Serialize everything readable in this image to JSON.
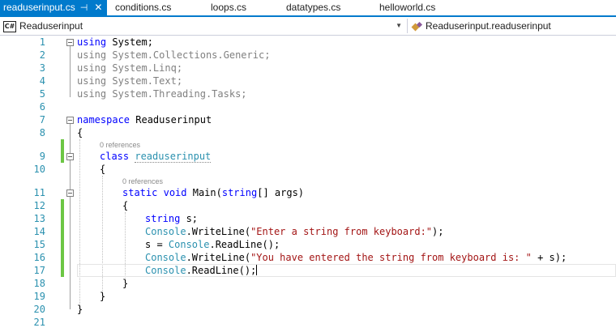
{
  "tabs": [
    {
      "label": "readuserinput.cs",
      "active": true,
      "pin": "⊣",
      "close": "✕"
    },
    {
      "label": "conditions.cs"
    },
    {
      "label": "loops.cs"
    },
    {
      "label": "datatypes.cs"
    },
    {
      "label": "helloworld.cs"
    }
  ],
  "nav": {
    "project_badge": "C#",
    "project": "Readuserinput",
    "member": "Readuserinput.readuserinput",
    "dropdown_glyph": "▼"
  },
  "code_lens": {
    "references": "0 references"
  },
  "code": {
    "line1_kw": "using",
    "line1_rest": " System;",
    "line2": "using System.Collections.Generic;",
    "line3": "using System.Linq;",
    "line4": "using System.Text;",
    "line5": "using System.Threading.Tasks;",
    "line7_kw": "namespace",
    "line7_rest": " Readuserinput",
    "open_brace": "{",
    "close_brace": "}",
    "line9_kw": "class",
    "line9_name": "readuserinput",
    "line11_kw1": "static",
    "line11_kw2": "void",
    "line11_mid": " Main(",
    "line11_kw3": "string",
    "line11_end": "[] args)",
    "line13_kw": "string",
    "line13_rest": " s;",
    "console": "Console",
    "line14_a": ".WriteLine(",
    "line14_str": "\"Enter a string from keyboard:\"",
    "line14_end": ");",
    "line15_a": "s = ",
    "line15_b": ".ReadLine();",
    "line16_a": ".WriteLine(",
    "line16_str": "\"You have entered the string from keyboard is: \"",
    "line16_end": " + s);",
    "line17_a": ".ReadLine();"
  },
  "line_numbers": [
    "1",
    "2",
    "3",
    "4",
    "5",
    "6",
    "7",
    "8",
    "9",
    "10",
    "11",
    "12",
    "13",
    "14",
    "15",
    "16",
    "17",
    "18",
    "19",
    "20",
    "21"
  ],
  "colors": {
    "tab_active": "#007acc",
    "line_number": "#2b91af",
    "keyword": "#0000ff",
    "type": "#2b91af",
    "string": "#a31515",
    "change_marker": "#6cc644"
  }
}
